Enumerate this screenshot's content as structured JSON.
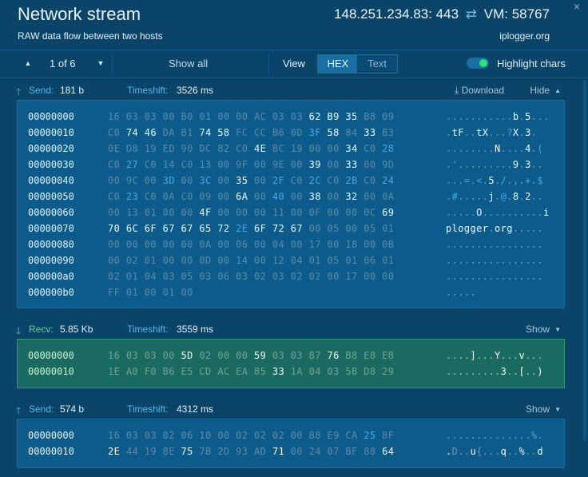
{
  "header": {
    "title": "Network stream",
    "subtitle": "RAW data flow between two hosts",
    "address": "148.251.234.83: 443",
    "vm": "VM: 58767",
    "brand": "iplogger.org",
    "close_glyph": "×"
  },
  "toolbar": {
    "page_indicator": "1 of 6",
    "show_all": "Show all",
    "view_label": "View",
    "view_options": [
      "HEX",
      "Text"
    ],
    "active_view": "HEX",
    "highlight_label": "Highlight chars",
    "highlight_on": true
  },
  "colors": {
    "background": "#0a4468",
    "send_accent": "#5fb3e8",
    "recv_accent": "#5fd39a",
    "highlight_byte": "#eef7fd",
    "blue_byte": "#41a8ef"
  },
  "sections": [
    {
      "direction": "Send:",
      "arrow": "up-arrow-icon",
      "size": "181 b",
      "timeshift_label": "Timeshift:",
      "timeshift": "3526 ms",
      "download": "Download",
      "toggle": "Hide",
      "expanded": true,
      "rows": [
        {
          "offset": "00000000",
          "bytes": "16 03 03 00 B0 01 00 00 AC 03 03 [62] [B9] [35] B8 09",
          "ascii": "...........[b].[5]..."
        },
        {
          "offset": "00000010",
          "bytes": "C0 [74] [46] DA B1 [74] [58] FC CC B6 0D {3F} [58] 84 [33] B3",
          "ascii": ".[t][F]..[t][X]...{?}[X].[3]."
        },
        {
          "offset": "00000020",
          "bytes": "0E D8 19 ED 90 DC 82 C0 [4E] BC 19 00 00 [34] C0 {28}",
          "ascii": "........[N]....[4].{(}"
        },
        {
          "offset": "00000030",
          "bytes": "C0 {27} C0 14 C0 13 00 9F 00 9E 00 [39] 00 [33] 00 9D",
          "ascii": ".{'}.........[9].[3].."
        },
        {
          "offset": "00000040",
          "bytes": "00 9C 00 {3D} 00 {3C} 00 [35] 00 {2F} C0 {2C} C0 {2B} C0 {24}",
          "ascii": "...{=}.{<}.[5].{/}.{,}.{+}.{$}"
        },
        {
          "offset": "00000050",
          "bytes": "C0 {23} C0 0A C0 09 00 [6A] 00 {40} 00 [38] 00 [32] 00 0A",
          "ascii": ".{#}.....[j].{@}.[8].[2].."
        },
        {
          "offset": "00000060",
          "bytes": "00 13 01 00 00 [4F] 00 00 00 11 00 0F 00 00 0C [69]",
          "ascii": ".....[O]..........[i]"
        },
        {
          "offset": "00000070",
          "bytes": "[70] [6C] [6F] [67] [67] [65] [72] {2E} [6F] [72] [67] 00 05 00 05 01",
          "ascii": "[p][l][o][g][g][e][r]{.}[o][r][g]....."
        },
        {
          "offset": "00000080",
          "bytes": "00 00 00 00 00 0A 00 06 00 04 00 17 00 18 00 0B",
          "ascii": "................"
        },
        {
          "offset": "00000090",
          "bytes": "00 02 01 00 00 0D 00 14 00 12 04 01 05 01 06 01",
          "ascii": "................"
        },
        {
          "offset": "000000a0",
          "bytes": "02 01 04 03 05 03 06 03 02 03 02 02 00 17 00 00",
          "ascii": "................"
        },
        {
          "offset": "000000b0",
          "bytes": "FF 01 00 01 00",
          "ascii": "....."
        }
      ]
    },
    {
      "direction": "Recv:",
      "arrow": "down-arrow-icon",
      "size": "5.85 Kb",
      "timeshift_label": "Timeshift:",
      "timeshift": "3559 ms",
      "toggle": "Show",
      "expanded": false,
      "rows": [
        {
          "offset": "00000000",
          "bytes": "16 03 03 00 [5D] 02 00 00 [59] 03 03 87 [76] B8 E8 E8",
          "ascii": "....[]]...[Y]...[v]..."
        },
        {
          "offset": "00000010",
          "bytes": "1E A0 F0 B6 E5 CD AC EA 85 [33] 1A 04 03 5B D8 29",
          "ascii": ".........[3]..[[]..[)]"
        }
      ]
    },
    {
      "direction": "Send:",
      "arrow": "up-arrow-icon",
      "size": "574 b",
      "timeshift_label": "Timeshift:",
      "timeshift": "4312 ms",
      "toggle": "Show",
      "expanded": false,
      "rows": [
        {
          "offset": "00000000",
          "bytes": "16 03 03 02 06 10 00 02 02 02 00 88 E9 CA {25} 8F",
          "ascii": "..............{%}."
        },
        {
          "offset": "00000010",
          "bytes": "[2E] 44 19 8E [75] 7B 2D 93 AD [71] 00 24 07 BF 88 [64]",
          "ascii": "[.]D..[u]{...[q]..[%]..[d]"
        }
      ]
    }
  ]
}
